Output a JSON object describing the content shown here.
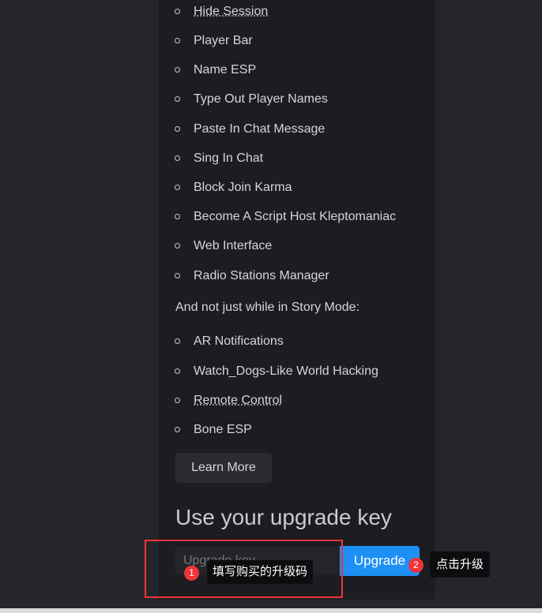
{
  "features": [
    "Hide Session",
    "Player Bar",
    "Name ESP",
    "Type Out Player Names",
    "Paste In Chat Message",
    "Sing In Chat",
    "Block Join Karma",
    "Become A Script Host Kleptomaniac",
    "Web Interface",
    "Radio Stations Manager"
  ],
  "story_note": "And not just while in Story Mode:",
  "global_features": [
    "AR Notifications",
    "Watch_Dogs-Like World Hacking",
    "Remote Control",
    "Bone ESP"
  ],
  "learn_more": "Learn More",
  "upgrade_heading": "Use your upgrade key",
  "upgrade_input_placeholder": "Upgrade key",
  "upgrade_button": "Upgrade",
  "annotations": [
    {
      "num": "1",
      "text": "填写购买的升级码"
    },
    {
      "num": "2",
      "text": "点击升级"
    }
  ],
  "colors": {
    "accent": "#1e90f5",
    "annotation": "#f0343a"
  }
}
